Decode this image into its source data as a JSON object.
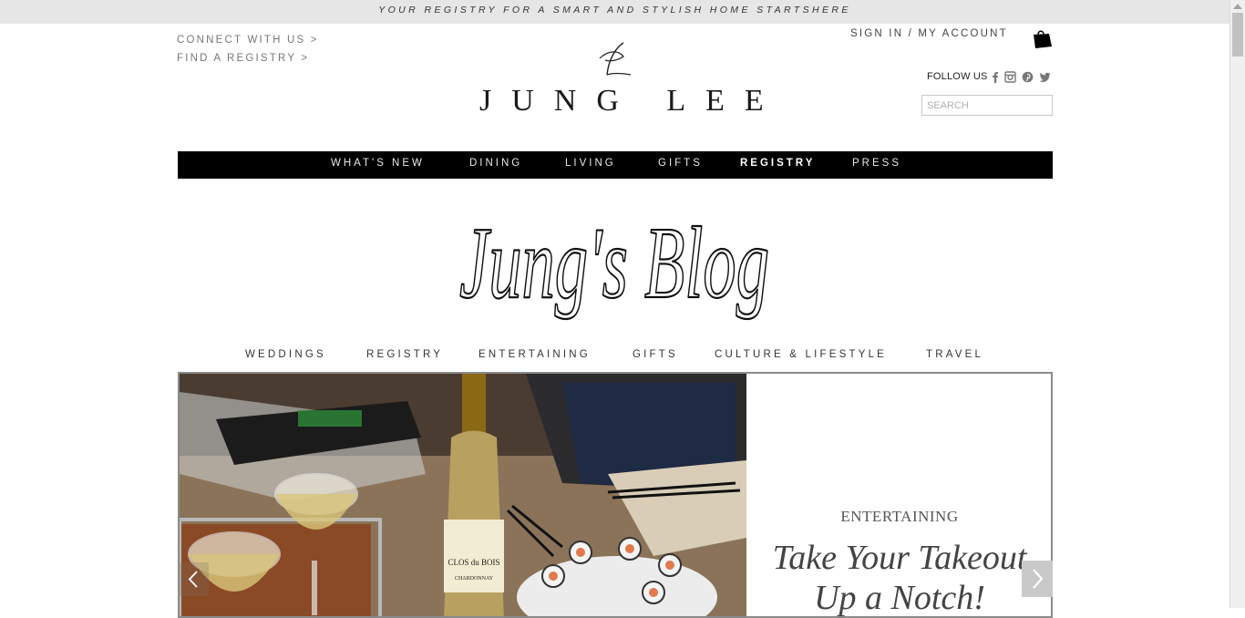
{
  "banner": {
    "text": "YOUR REGISTRY FOR A SMART AND STYLISH HOME STARTSHERE"
  },
  "toplinks": {
    "connect": "CONNECT WITH US >",
    "find_registry": "FIND A REGISTRY >"
  },
  "logo": {
    "text": "JUNG LEE"
  },
  "account": {
    "text": "SIGN IN / MY ACCOUNT"
  },
  "follow": {
    "label": "FOLLOW US",
    "icons": [
      "facebook-icon",
      "instagram-icon",
      "pinterest-icon",
      "twitter-icon"
    ]
  },
  "search": {
    "placeholder": "SEARCH",
    "value": ""
  },
  "mainnav": {
    "items": [
      "WHAT'S NEW",
      "DINING",
      "LIVING",
      "GIFTS",
      "REGISTRY",
      "PRESS"
    ],
    "active": "REGISTRY"
  },
  "blog": {
    "title": "Jung's Blog"
  },
  "blognav": {
    "items": [
      "WEDDINGS",
      "REGISTRY",
      "ENTERTAINING",
      "GIFTS",
      "CULTURE & LIFESTYLE",
      "TRAVEL"
    ]
  },
  "slide": {
    "category": "ENTERTAINING",
    "headline_line1": "Take Your Takeout",
    "headline_line2": "Up a Notch!",
    "wine_label_top": "CLOS du BOIS",
    "wine_label_bottom": "CHARDONNAY"
  },
  "colors": {
    "nav_bg": "#000000",
    "banner_bg": "#e6e6e6",
    "text": "#333333"
  }
}
